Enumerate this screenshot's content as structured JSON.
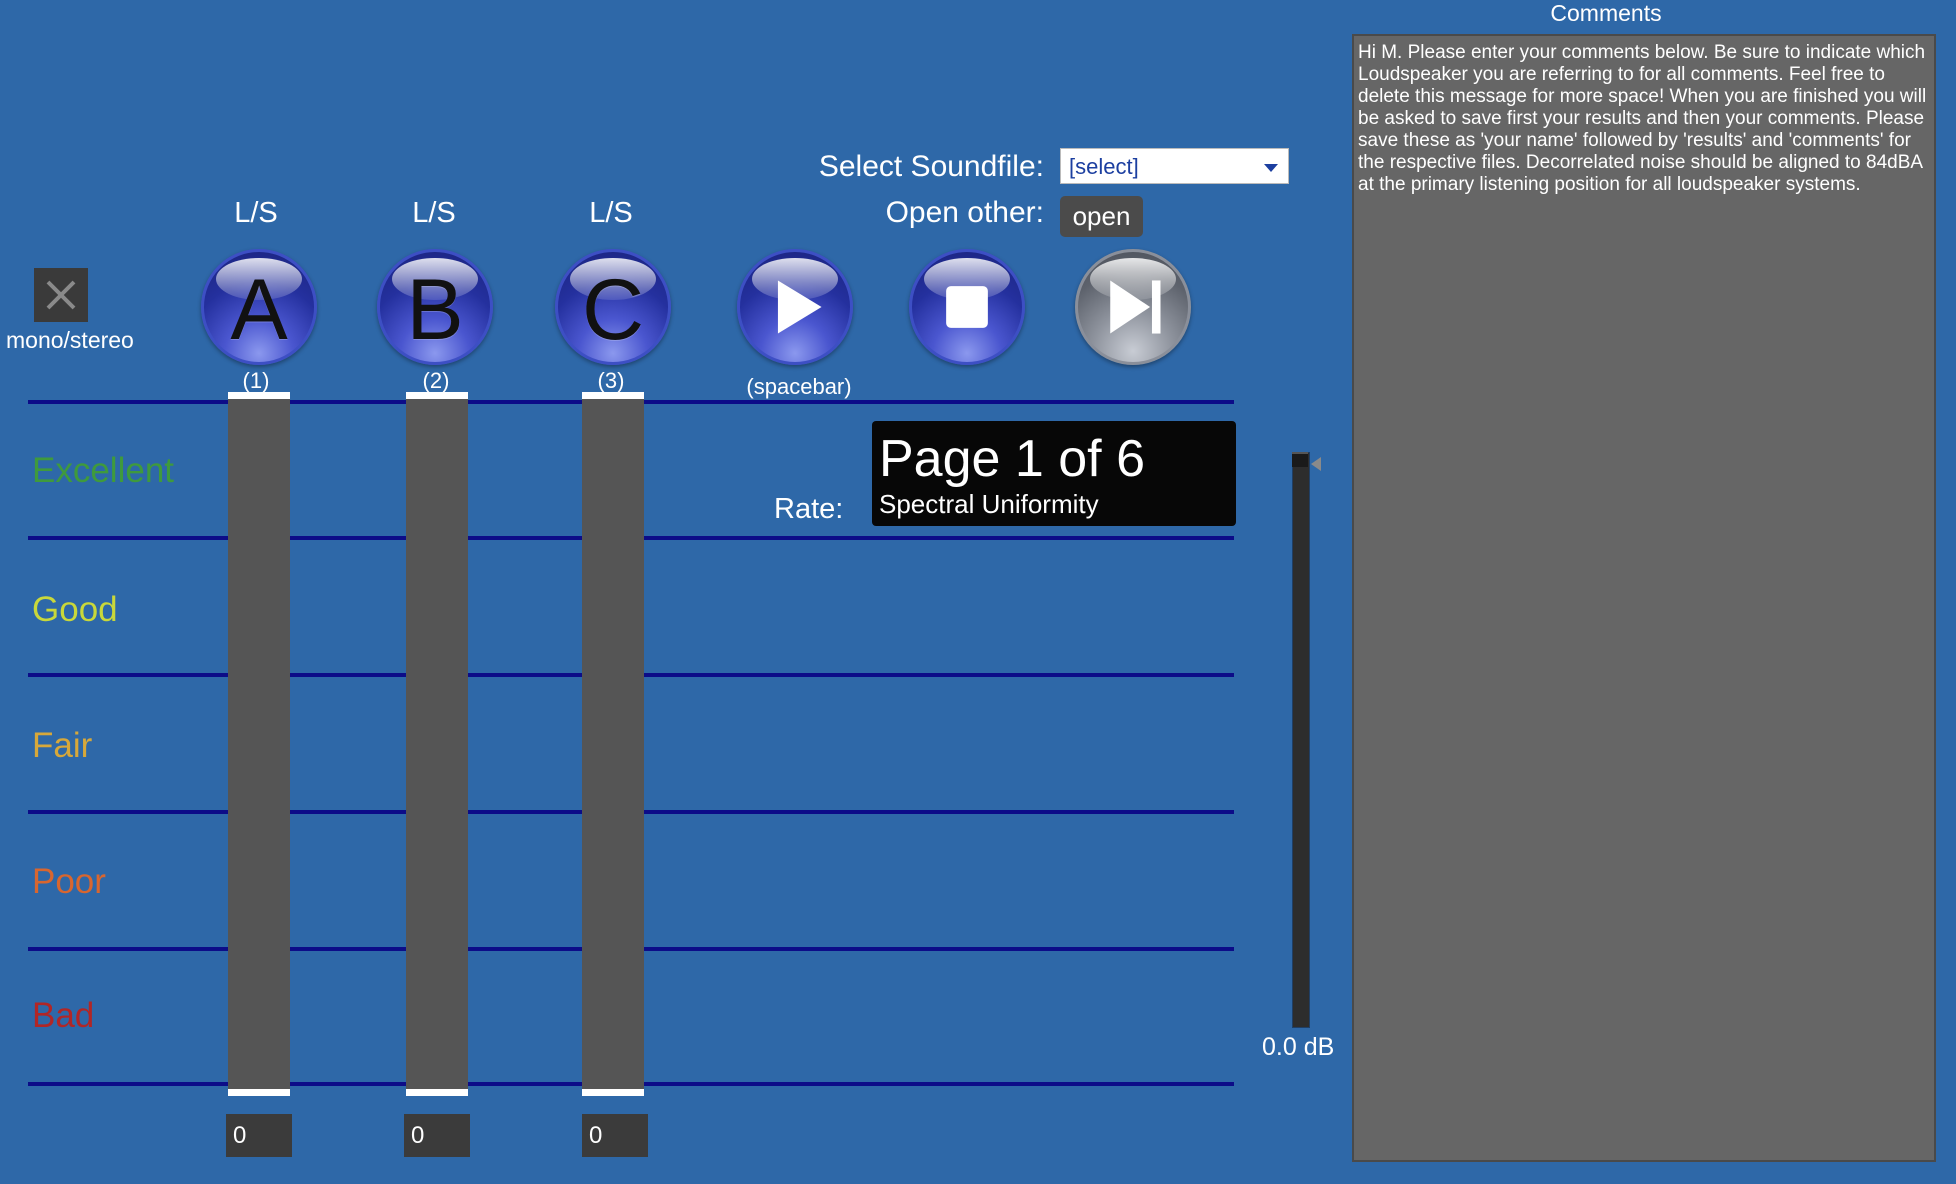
{
  "comments": {
    "title": "Comments",
    "text": "Hi M. Please enter your comments below. Be sure to indicate which Loudspeaker you are referring to for all comments. Feel free to delete this message for more space! When you are finished you will be asked to save first your results and then your comments. Please save these as 'your name' followed by 'results' and 'comments' for the respective files. Decorrelated noise should be aligned to 84dBA at the primary listening position for all loudspeaker systems."
  },
  "soundfile": {
    "label": "Select Soundfile:",
    "selected": "[select]"
  },
  "open_other": {
    "label": "Open other:",
    "button": "open"
  },
  "mono_stereo": {
    "label": "mono/stereo",
    "icon": "x-icon"
  },
  "loudspeakers": [
    {
      "top_label": "L/S",
      "letter": "A",
      "shortcut": "(1)",
      "value": "0"
    },
    {
      "top_label": "L/S",
      "letter": "B",
      "shortcut": "(2)",
      "value": "0"
    },
    {
      "top_label": "L/S",
      "letter": "C",
      "shortcut": "(3)",
      "value": "0"
    }
  ],
  "transport": {
    "play_shortcut": "(spacebar)",
    "play_icon": "play-icon",
    "stop_icon": "stop-icon",
    "next_icon": "skip-next-icon"
  },
  "scale": {
    "categories": [
      {
        "label": "Excellent",
        "color": "#3f9a3d"
      },
      {
        "label": "Good",
        "color": "#c9d83a"
      },
      {
        "label": "Fair",
        "color": "#d7a83a"
      },
      {
        "label": "Poor",
        "color": "#d8662f"
      },
      {
        "label": "Bad",
        "color": "#b12626"
      }
    ]
  },
  "rate": {
    "label": "Rate:",
    "page": "Page 1 of 6",
    "attribute": "Spectral Uniformity"
  },
  "meter": {
    "readout": "0.0 dB"
  },
  "colors": {
    "background": "#2e68a8",
    "scale_line": "#0c0c88",
    "button_blue": "#24309e"
  }
}
